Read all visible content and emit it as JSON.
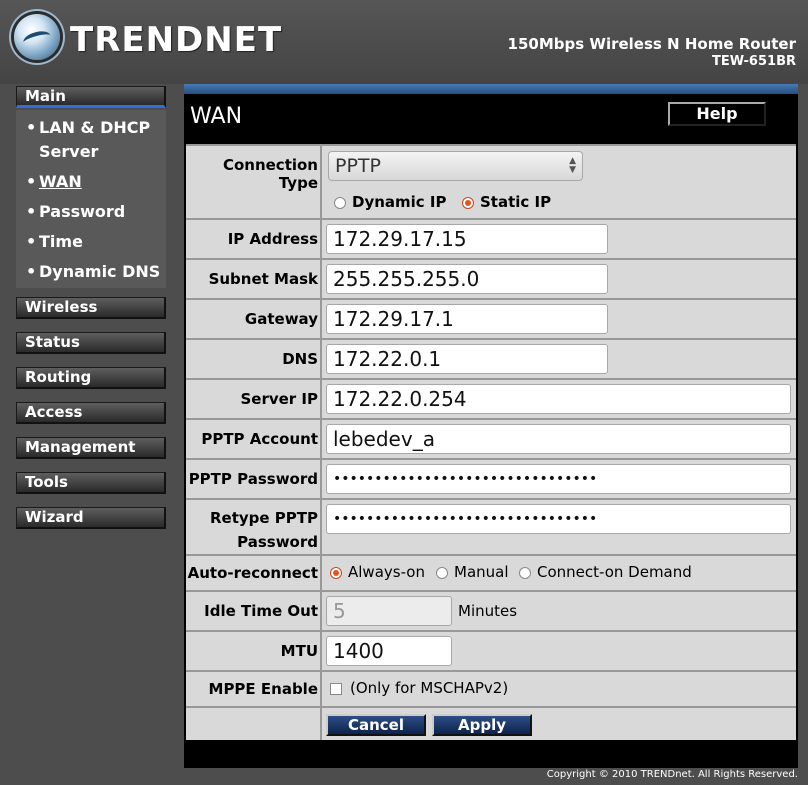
{
  "header": {
    "brand": "TRENDNET",
    "product_line": "150Mbps Wireless N Home Router",
    "model": "TEW-651BR"
  },
  "sidebar": {
    "main_label": "Main",
    "submenu": [
      {
        "label_line1": "LAN & DHCP",
        "label_line2": "Server"
      },
      {
        "label_line1": "WAN",
        "label_line2": ""
      },
      {
        "label_line1": "Password",
        "label_line2": ""
      },
      {
        "label_line1": "Time",
        "label_line2": ""
      },
      {
        "label_line1": "Dynamic DNS",
        "label_line2": ""
      }
    ],
    "bullet": "•",
    "sections": [
      "Wireless",
      "Status",
      "Routing",
      "Access",
      "Management",
      "Tools",
      "Wizard"
    ]
  },
  "panel": {
    "title": "WAN",
    "help_label": "Help"
  },
  "form": {
    "connection_type": {
      "label": "Connection Type",
      "selected": "PPTP",
      "options": [
        "Dynamic IP",
        "Static IP"
      ],
      "selected_option": "Static IP"
    },
    "ip_address": {
      "label": "IP Address",
      "value": "172.29.17.15"
    },
    "subnet_mask": {
      "label": "Subnet Mask",
      "value": "255.255.255.0"
    },
    "gateway": {
      "label": "Gateway",
      "value": "172.29.17.1"
    },
    "dns": {
      "label": "DNS",
      "value": "172.22.0.1"
    },
    "server_ip": {
      "label": "Server IP",
      "value": "172.22.0.254"
    },
    "pptp_account": {
      "label": "PPTP Account",
      "value": "lebedev_a"
    },
    "pptp_password": {
      "label": "PPTP Password",
      "value": "••••••••••••••••••••••••••••••••"
    },
    "retype_password": {
      "label_line1": "Retype PPTP",
      "label_line2": "Password",
      "value": "••••••••••••••••••••••••••••••••"
    },
    "auto_reconnect": {
      "label": "Auto-reconnect",
      "options": [
        "Always-on",
        "Manual",
        "Connect-on Demand"
      ],
      "selected": "Always-on"
    },
    "idle_time_out": {
      "label": "Idle Time Out",
      "value": "5",
      "unit": "Minutes"
    },
    "mtu": {
      "label": "MTU",
      "value": "1400"
    },
    "mppe": {
      "label": "MPPE Enable",
      "checked": false,
      "note": "(Only for MSCHAPv2)"
    },
    "buttons": {
      "cancel": "Cancel",
      "apply": "Apply"
    }
  },
  "footer": {
    "copyright": "Copyright © 2010 TRENDnet. All Rights Reserved."
  },
  "colors": {
    "background": "#4d4d4d",
    "panel_bar": "#23507f",
    "button_blue": "#1b3868",
    "radio_selected": "#e2541f",
    "label_bg": "#d9d9d9"
  }
}
